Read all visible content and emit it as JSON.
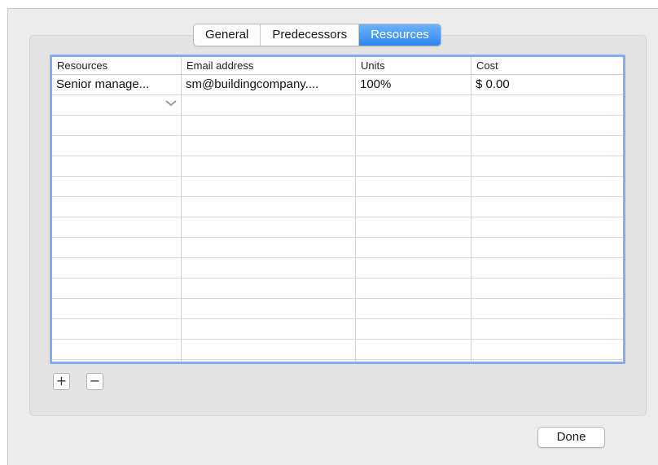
{
  "tabs": [
    {
      "label": "General",
      "selected": false
    },
    {
      "label": "Predecessors",
      "selected": false
    },
    {
      "label": "Resources",
      "selected": true
    }
  ],
  "table": {
    "headers": [
      "Resources",
      "Email address",
      "Units",
      "Cost"
    ],
    "rows": [
      {
        "resource": "Senior manage...",
        "email": "sm@buildingcompany....",
        "units": "100%",
        "cost": "$ 0.00"
      }
    ],
    "new_row_dropdown_icon": "chevron-down-icon"
  },
  "buttons": {
    "add_label": "+",
    "remove_label": "−",
    "done_label": "Done"
  },
  "colors": {
    "accent": "#2f86f0",
    "table_focus_border": "#82aef0"
  }
}
